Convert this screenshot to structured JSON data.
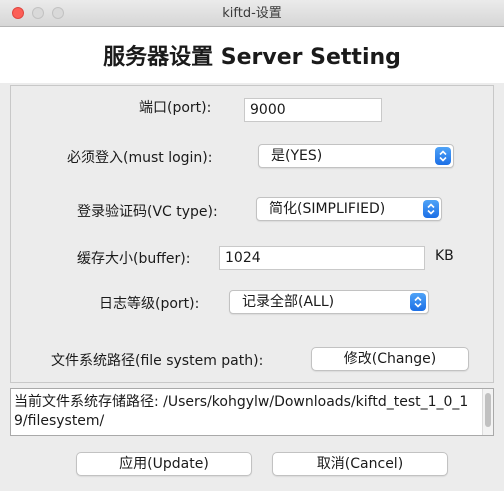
{
  "window": {
    "title": "kiftd-设置"
  },
  "header": {
    "title": "服务器设置 Server Setting"
  },
  "form": {
    "port": {
      "label": "端口(port):",
      "value": "9000"
    },
    "must_login": {
      "label": "必须登入(must login):",
      "selected": "是(YES)"
    },
    "vc_type": {
      "label": "登录验证码(VC type):",
      "selected": "简化(SIMPLIFIED)"
    },
    "buffer": {
      "label": "缓存大小(buffer):",
      "value": "1024",
      "unit": "KB"
    },
    "log_level": {
      "label": "日志等级(port):",
      "selected": "记录全部(ALL)"
    },
    "file_system_path": {
      "label": "文件系统路径(file system path):",
      "change_label": "修改(Change)"
    }
  },
  "path_display": {
    "text": "当前文件系统存储路径: /Users/kohgylw/Downloads/kiftd_test_1_0_19/filesystem/"
  },
  "footer": {
    "update_label": "应用(Update)",
    "cancel_label": "取消(Cancel)"
  },
  "colors": {
    "accent": "#1c6fe6",
    "close": "#fc5f57",
    "window_bg": "#ececec"
  }
}
